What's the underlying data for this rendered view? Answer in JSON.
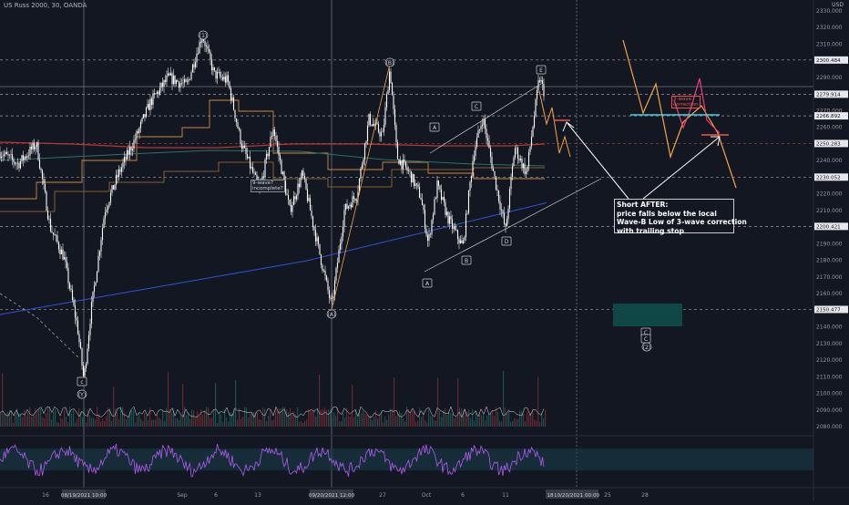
{
  "symbol": {
    "title": "US Russ 2000, 30, OANDA",
    "currency": "USD"
  },
  "price_axis": {
    "labels": [
      "2330.000",
      "2320.000",
      "2310.000",
      "2290.000",
      "2280.000",
      "2270.000",
      "2260.000",
      "2240.000",
      "2230.000",
      "2220.000",
      "2210.000",
      "2200.000",
      "2190.000",
      "2180.000",
      "2170.000",
      "2160.000",
      "2140.000",
      "2130.000",
      "2120.000",
      "2110.000",
      "2100.000",
      "2090.000",
      "2080.000"
    ],
    "values": [
      2330,
      2320,
      2310,
      2290,
      2280,
      2270,
      2260,
      2240,
      2230,
      2220,
      2210,
      2200,
      2190,
      2180,
      2170,
      2160,
      2140,
      2130,
      2120,
      2110,
      2100,
      2090,
      2080
    ],
    "marked_levels": [
      {
        "label": "2300.484",
        "value": 2300.484
      },
      {
        "label": "2279.914",
        "value": 2279.914
      },
      {
        "label": "2266.892",
        "value": 2266.892
      },
      {
        "label": "2250.283",
        "value": 2250.283
      },
      {
        "label": "2230.052",
        "value": 2230.052
      },
      {
        "label": "2200.421",
        "value": 2200.421
      },
      {
        "label": "2150.477",
        "value": 2150.477
      }
    ]
  },
  "indicator_axis": {
    "labels": [
      "80.00",
      "60.00",
      "40.00",
      "20.00"
    ]
  },
  "time_axis": {
    "labels": [
      "16",
      "Sep",
      "6",
      "13",
      "27",
      "Oct",
      "6",
      "11",
      "25",
      "28"
    ],
    "highlights": [
      "08/19/2021  10:00",
      "09/20/2021  12:00",
      "10/20/2021  00:00",
      "18"
    ]
  },
  "wave_labels": {
    "one": "(1)",
    "two": "(2)",
    "y": "(Y)",
    "a_low": "(A)",
    "b_high": "(B)",
    "A1": "A",
    "A2": "A",
    "B1": "B",
    "C1": "C",
    "D1": "D",
    "E1": "E",
    "c_small": "c",
    "C_upper": "C",
    "C_lower": "C"
  },
  "tags": {
    "nine_wave": [
      "9-wave?",
      "incomplete?"
    ],
    "three_wave": [
      "3-wave",
      "correction"
    ]
  },
  "note": {
    "lines": [
      "Short AFTER:",
      "price  falls below the local",
      "Wave-B Low of 3-wave correction",
      "with trailing stop"
    ]
  },
  "colors": {
    "background": "#131722",
    "candles": "#ffffff",
    "orange": "#f5a34a",
    "blue_line": "#3154c8",
    "red_line": "#b03a3a",
    "teal_zone": "#0f4a4a",
    "pink_path": "#ec407a",
    "cyan": "#4dd0e1",
    "rsi": "#b05cf0"
  }
}
